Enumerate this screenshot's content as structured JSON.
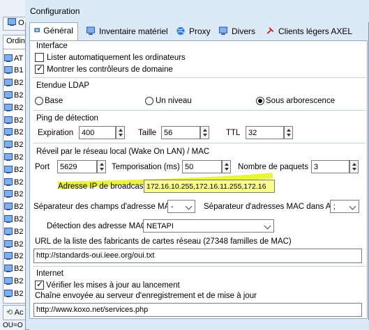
{
  "bg": {
    "tab1": "O",
    "tab2": "Ordina",
    "rows": [
      "AT",
      "B1",
      "B2",
      "B2",
      "B2",
      "B2",
      "B2",
      "B2",
      "B2",
      "B2",
      "B2",
      "B2",
      "B2",
      "B2",
      "B2",
      "B2",
      "B2",
      "B2",
      "B2",
      "B2"
    ],
    "bottom_btn": "Ac",
    "status": "OU=O"
  },
  "dialog": {
    "title": "Configuration"
  },
  "tabs": [
    {
      "label": "Général",
      "icon": "settings-icon"
    },
    {
      "label": "Inventaire matériel",
      "icon": "monitor-icon"
    },
    {
      "label": "Proxy",
      "icon": "globe-icon"
    },
    {
      "label": "Divers",
      "icon": "monitor-icon"
    },
    {
      "label": "Clients légers AXEL",
      "icon": "plug-icon"
    }
  ],
  "interface": {
    "title": "Interface",
    "auto_list": "Lister automatiquement les ordinateurs",
    "auto_list_checked": false,
    "show_dc": "Montrer les contrôleurs de domaine",
    "show_dc_checked": true
  },
  "ldap": {
    "title": "Etendue LDAP",
    "options": [
      "Base",
      "Un niveau",
      "Sous arborescence"
    ],
    "selected": "Sous arborescence"
  },
  "ping": {
    "title": "Ping de détection",
    "expiration_label": "Expiration",
    "expiration": "400",
    "size_label": "Taille",
    "size": "56",
    "ttl_label": "TTL",
    "ttl": "32"
  },
  "wol": {
    "title": "Réveil par le réseau local (Wake On LAN)  / MAC",
    "port_label": "Port",
    "port": "5629",
    "delay_label": "Temporisation (ms)",
    "delay": "50",
    "packets_label": "Nombre de paquets",
    "packets": "3",
    "broadcast_label": "Adresse IP de broadcast",
    "broadcast": "172.16.10.255,172.16.11.255,172.16",
    "mac_sep_label": "Séparateur des champs d'adresse MAC",
    "mac_sep": "-",
    "mac_ad_sep_label": "Séparateur d'adresses MAC dans AD",
    "mac_ad_sep": ";",
    "detect_label": "Détection des adresse MAC",
    "detect": "NETAPI",
    "url_label": "URL de la liste des fabricants de cartes réseau (27348 familles de MAC)",
    "url": "http://standards-oui.ieee.org/oui.txt"
  },
  "internet": {
    "title": "Internet",
    "check_updates": "Vérifier les mises à jour au lancement",
    "check_updates_checked": true,
    "chain_label": "Chaîne envoyée au serveur d'enregistrement et de mise à jour",
    "chain": "http://www.koxo.net/services.php"
  },
  "colors": {
    "highlight": "#f3f51a",
    "accent": "#dce9f7"
  }
}
